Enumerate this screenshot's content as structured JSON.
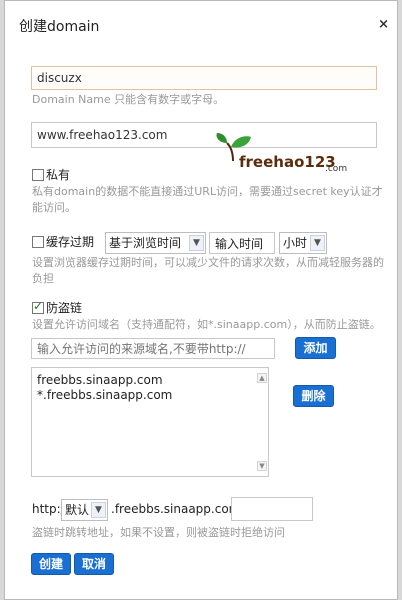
{
  "dialog": {
    "title": "创建domain",
    "close_glyph": "×"
  },
  "domain_name": {
    "value": "discuzx",
    "hint": "Domain Name 只能含有数字或字母。"
  },
  "url": {
    "value": "www.freehao123.com"
  },
  "logo": {
    "text": "freehao123",
    "sub": ".com"
  },
  "private": {
    "label": "私有",
    "checked": false,
    "hint": "私有domain的数据不能直接通过URL访问，需要通过secret key认证才能访问。"
  },
  "cache": {
    "label": "缓存过期",
    "checked": false,
    "mode_select": "基于浏览时间",
    "time_input_value": "输入时间",
    "unit_select": "小时",
    "hint": "设置浏览器缓存过期时间，可以减少文件的请求次数，从而减轻服务器的负担"
  },
  "hotlink": {
    "label": "防盗链",
    "checked": true,
    "hint": "设置允许访问域名（支持通配符，如*.sinaapp.com），从而防止盗链。",
    "input_placeholder": "输入允许访问的来源域名,不要带http://",
    "add_button": "添加",
    "delete_button": "删除",
    "domains": [
      "freebbs.sinaapp.com",
      "*.freebbs.sinaapp.com"
    ]
  },
  "redirect": {
    "prefix": "http://",
    "select": "默认",
    "domain": ".freebbs.sinaapp.com/",
    "path_value": "",
    "hint": "盗链时跳转地址，如果不设置，则被盗链时拒绝访问"
  },
  "actions": {
    "create": "创建",
    "cancel": "取消"
  },
  "colors": {
    "button_blue": "#1a6fd3",
    "hint_gray": "#999999",
    "focus_border": "#e6bf9b"
  }
}
